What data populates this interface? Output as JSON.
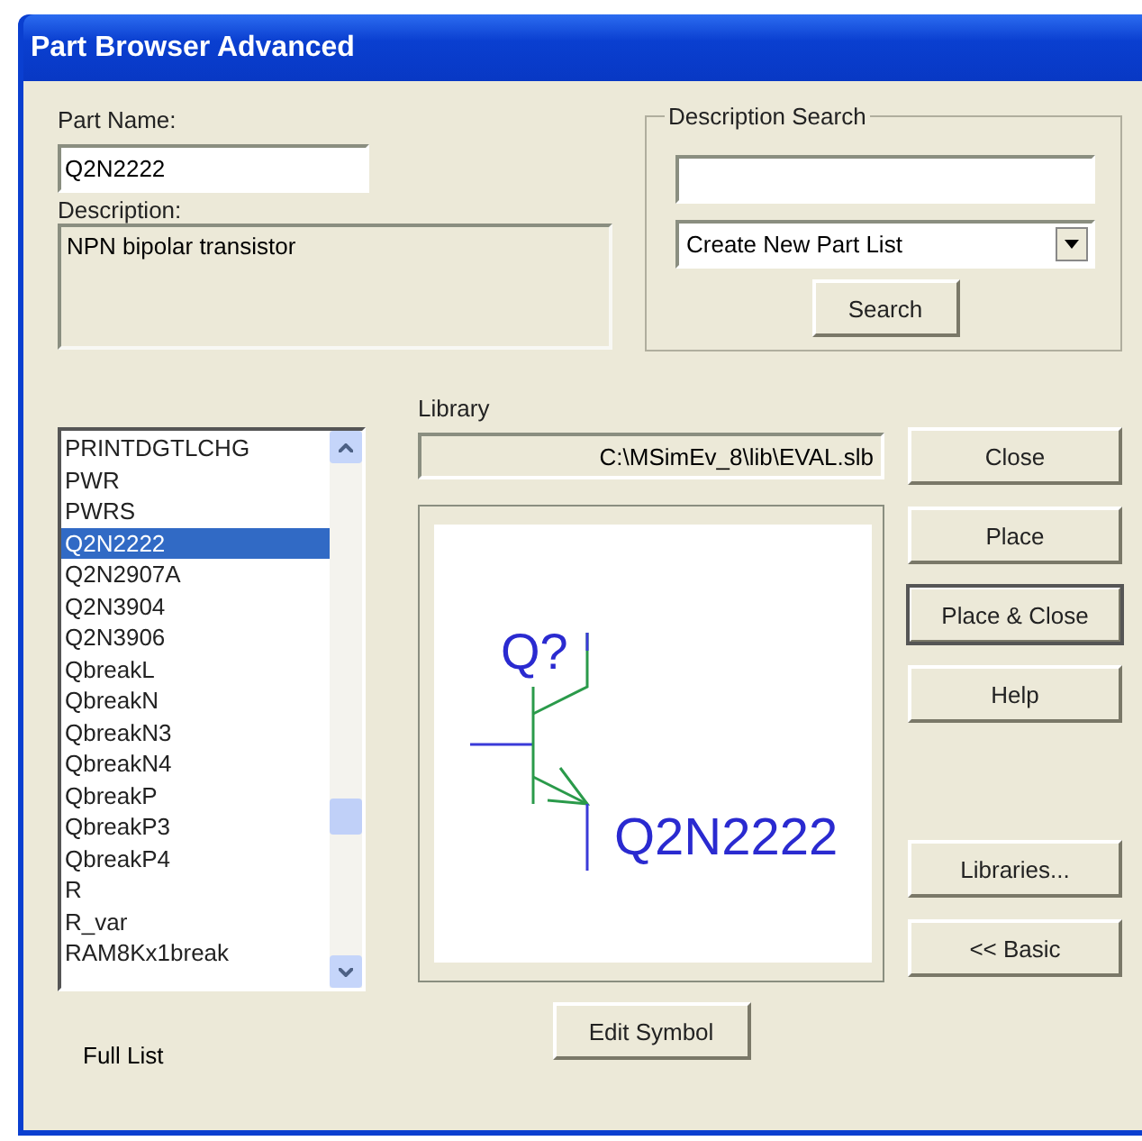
{
  "window": {
    "title": "Part Browser Advanced"
  },
  "part_name": {
    "label": "Part Name:",
    "value": "Q2N2222"
  },
  "description": {
    "label": "Description:",
    "value": "NPN bipolar transistor"
  },
  "description_search": {
    "legend": "Description Search",
    "list_combo": {
      "value": "Create New Part List"
    },
    "search_button": "Search"
  },
  "parts_list": {
    "items": [
      {
        "label": "PRINTDGTLCHG",
        "selected": false
      },
      {
        "label": "PWR",
        "selected": false
      },
      {
        "label": "PWRS",
        "selected": false
      },
      {
        "label": "Q2N2222",
        "selected": true
      },
      {
        "label": "Q2N2907A",
        "selected": false
      },
      {
        "label": "Q2N3904",
        "selected": false
      },
      {
        "label": "Q2N3906",
        "selected": false
      },
      {
        "label": "QbreakL",
        "selected": false
      },
      {
        "label": "QbreakN",
        "selected": false
      },
      {
        "label": "QbreakN3",
        "selected": false
      },
      {
        "label": "QbreakN4",
        "selected": false
      },
      {
        "label": "QbreakP",
        "selected": false
      },
      {
        "label": "QbreakP3",
        "selected": false
      },
      {
        "label": "QbreakP4",
        "selected": false
      },
      {
        "label": "R",
        "selected": false
      },
      {
        "label": "R_var",
        "selected": false
      },
      {
        "label": "RAM8Kx1break",
        "selected": false
      }
    ],
    "footer": "Full List"
  },
  "library": {
    "label": "Library",
    "path": "C:\\MSimEv_8\\lib\\EVAL.slb"
  },
  "preview": {
    "reference": "Q?",
    "part": "Q2N2222"
  },
  "edit_symbol_button": "Edit Symbol",
  "buttons": [
    {
      "label": "Close",
      "default": false
    },
    {
      "label": "Place",
      "default": false
    },
    {
      "label": "Place & Close",
      "default": true
    },
    {
      "label": "Help",
      "default": false
    }
  ],
  "lower_buttons": [
    {
      "label": "Libraries...",
      "default": false
    },
    {
      "label": "<< Basic",
      "default": false
    }
  ]
}
